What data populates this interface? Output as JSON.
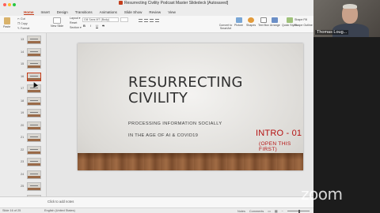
{
  "window": {
    "title": "Resurrecting Civility Podcast Master Slidedeck [Autosaved]"
  },
  "ribbon": {
    "tabs": [
      "Home",
      "Insert",
      "Design",
      "Transitions",
      "Animations",
      "Slide Show",
      "Review",
      "View"
    ],
    "active_tab": "Home",
    "clipboard": {
      "paste": "Paste",
      "cut": "Cut",
      "copy": "Copy",
      "format": "Format"
    },
    "slides": {
      "new_slide": "New Slide",
      "layout": "Layout",
      "reset": "Reset",
      "section": "Section"
    },
    "font_name": "Gill Sans MT (Body)",
    "format_buttons": [
      "B",
      "I",
      "U",
      "S"
    ],
    "right_tools": {
      "convert_smartart": "Convert to SmartArt",
      "picture": "Picture",
      "shapes": "Shapes",
      "text_box": "Text Box",
      "arrange": "Arrange",
      "quick_styles": "Quick Styles",
      "shape_fill": "Shape Fill",
      "shape_outline": "Shape Outline"
    },
    "accent_color": "#c43e1c"
  },
  "video": {
    "participant_name": "Thomas Loug...",
    "watermark": "zoom"
  },
  "thumbnails": {
    "numbers": [
      "13",
      "14",
      "15",
      "16",
      "17",
      "18",
      "19",
      "20",
      "21",
      "22",
      "23",
      "24",
      "25",
      "26"
    ],
    "selected": "16"
  },
  "slide": {
    "title_line1": "RESURRECTING",
    "title_line2": "CIVILITY",
    "subtitle_line1": "PROCESSING INFORMATION SOCIALLY",
    "subtitle_line2": "IN THE AGE OF AI & COVID19",
    "intro": "INTRO - 01",
    "open_first": "(OPEN THIS FIRST)",
    "accent_color": "#b51212"
  },
  "notes": {
    "placeholder": "Click to add notes"
  },
  "status_bar": {
    "slide_position": "Slide 16 of 25",
    "language": "English (United States)",
    "notes_label": "Notes",
    "comments_label": "Comments",
    "zoom_level": "110%"
  }
}
